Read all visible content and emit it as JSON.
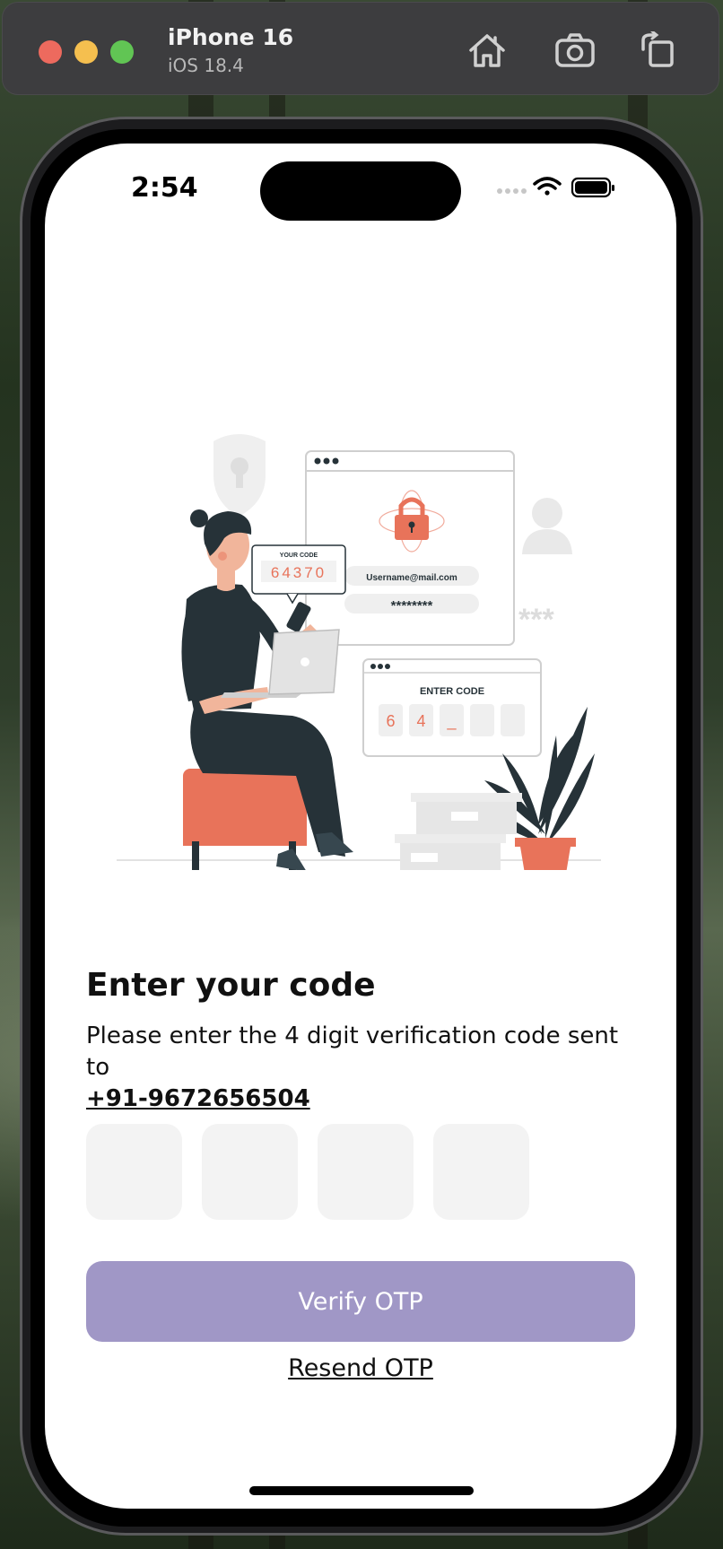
{
  "simulator": {
    "device_name": "iPhone 16",
    "os_version": "iOS 18.4",
    "icons": [
      "home-icon",
      "screenshot-icon",
      "rotate-icon"
    ]
  },
  "status_bar": {
    "time": "2:54",
    "icons": [
      "cellular-dots-icon",
      "wifi-icon",
      "battery-icon"
    ]
  },
  "illustration": {
    "your_code_label": "YOUR CODE",
    "your_code_value": "64370",
    "username": "Username@mail.com",
    "password_mask": "********",
    "enter_code_label": "ENTER CODE",
    "entered_digits": [
      "6",
      "4",
      "_",
      "",
      ""
    ],
    "decor_stars": "***"
  },
  "otp_screen": {
    "title": "Enter your code",
    "subtitle": "Please enter the 4 digit verification code sent to",
    "phone_number": "+91-9672656504",
    "otp_inputs": [
      {
        "value": "",
        "placeholder": ""
      },
      {
        "value": "",
        "placeholder": ""
      },
      {
        "value": "",
        "placeholder": ""
      },
      {
        "value": "",
        "placeholder": ""
      }
    ],
    "verify_label": "Verify OTP",
    "resend_label": "Resend OTP"
  },
  "colors": {
    "accent_button": "#a097c6",
    "input_fill": "#f3f3f3",
    "illustration_orange": "#e8735a",
    "illustration_dark": "#263238"
  }
}
